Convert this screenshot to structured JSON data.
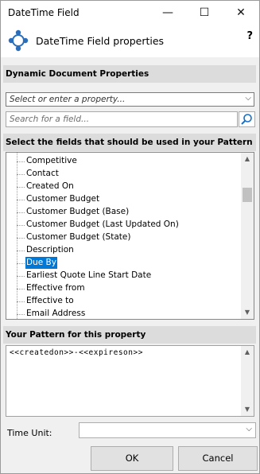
{
  "window": {
    "title": "DateTime Field"
  },
  "header": {
    "title": "DateTime Field properties",
    "help_label": "?"
  },
  "dynamic": {
    "section_title": "Dynamic Document Properties",
    "property_placeholder": "Select or enter a property...",
    "search_placeholder": "Search for a field..."
  },
  "fields": {
    "section_title": "Select the fields that should be used in your Pattern",
    "items": [
      "Competitive",
      "Contact",
      "Created On",
      "Customer Budget",
      "Customer Budget (Base)",
      "Customer Budget (Last Updated On)",
      "Customer Budget (State)",
      "Description",
      "Due By",
      "Earliest Quote Line Start Date",
      "Effective from",
      "Effective to",
      "Email Address"
    ],
    "selected_index": 8
  },
  "pattern": {
    "section_title": "Your Pattern for this property",
    "value": "<<createdon>>-<<expireson>>"
  },
  "time_unit": {
    "label": "Time Unit:",
    "value": ""
  },
  "buttons": {
    "ok": "OK",
    "cancel": "Cancel"
  },
  "colors": {
    "selection": "#0078d7",
    "section_bg": "#dcdcdc",
    "logo": "#2a6ebb"
  }
}
